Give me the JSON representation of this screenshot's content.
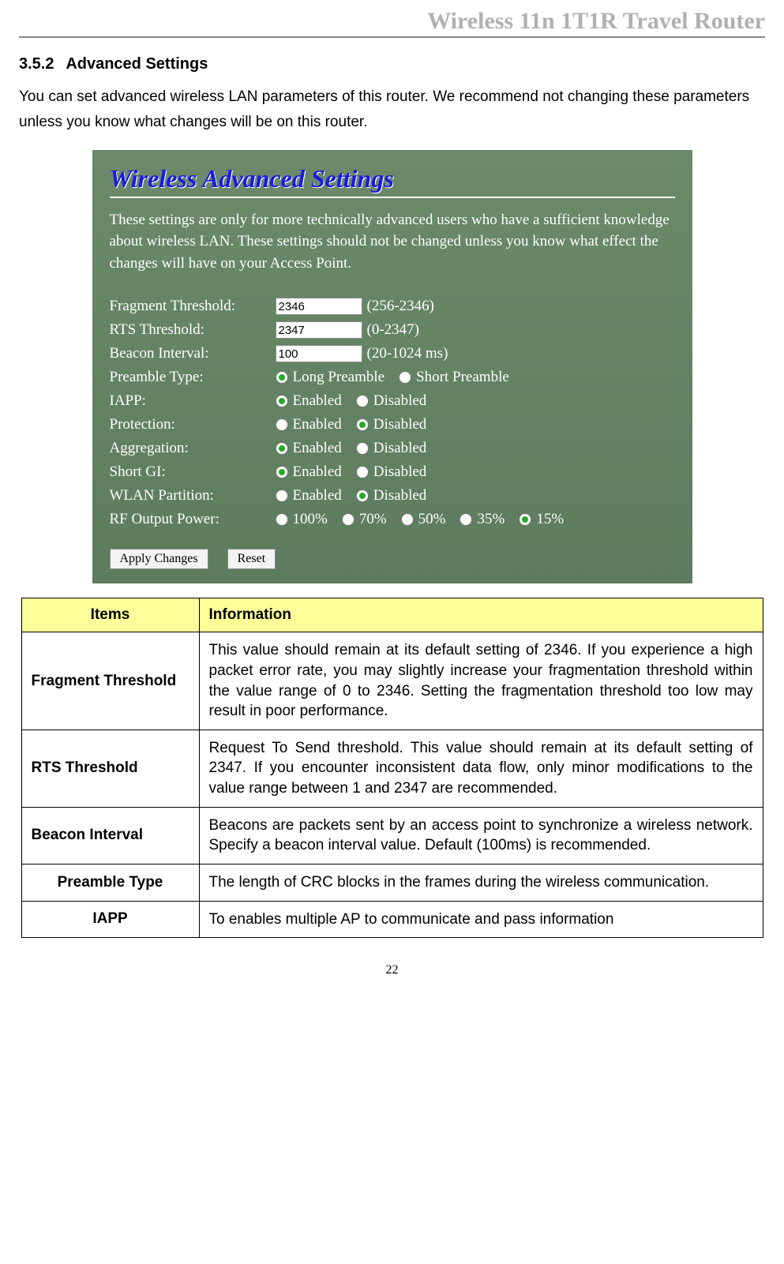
{
  "header": {
    "title": "Wireless 11n 1T1R Travel Router"
  },
  "section": {
    "number": "3.5.2",
    "title": "Advanced Settings",
    "intro": "You can set advanced wireless LAN parameters of this router. We recommend not changing these parameters unless you know what changes will be on this router."
  },
  "screenshot": {
    "title": "Wireless Advanced Settings",
    "desc": "These settings are only for more technically advanced users who have a sufficient knowledge about wireless LAN. These settings should not be changed unless you know what effect the changes will have on your Access Point.",
    "fields": {
      "fragment": {
        "label": "Fragment Threshold:",
        "value": "2346",
        "range": "(256-2346)"
      },
      "rts": {
        "label": "RTS Threshold:",
        "value": "2347",
        "range": "(0-2347)"
      },
      "beacon": {
        "label": "Beacon Interval:",
        "value": "100",
        "range": "(20-1024 ms)"
      },
      "preamble": {
        "label": "Preamble Type:",
        "opt1": "Long Preamble",
        "opt2": "Short Preamble",
        "selected": 0
      },
      "iapp": {
        "label": "IAPP:",
        "opt1": "Enabled",
        "opt2": "Disabled",
        "selected": 0
      },
      "protection": {
        "label": "Protection:",
        "opt1": "Enabled",
        "opt2": "Disabled",
        "selected": 1
      },
      "aggregation": {
        "label": "Aggregation:",
        "opt1": "Enabled",
        "opt2": "Disabled",
        "selected": 0
      },
      "shortgi": {
        "label": "Short GI:",
        "opt1": "Enabled",
        "opt2": "Disabled",
        "selected": 0
      },
      "wlan": {
        "label": "WLAN Partition:",
        "opt1": "Enabled",
        "opt2": "Disabled",
        "selected": 1
      },
      "rfpower": {
        "label": "RF Output Power:",
        "opts": [
          "100%",
          "70%",
          "50%",
          "35%",
          "15%"
        ],
        "selected": 4
      }
    },
    "buttons": {
      "apply": "Apply Changes",
      "reset": "Reset"
    }
  },
  "table": {
    "header": {
      "items": "Items",
      "info": "Information"
    },
    "rows": [
      {
        "item": "Fragment Threshold",
        "info": "This value should remain at its default setting of 2346. If you experience a high packet error rate, you may slightly increase your fragmentation threshold within the value range of 0 to 2346. Setting the fragmentation threshold too low may result in poor performance."
      },
      {
        "item": "RTS Threshold",
        "info": "Request To Send threshold. This value should remain at its default setting of 2347. If you encounter inconsistent data flow, only minor modifications to the value range between 1 and 2347 are recommended."
      },
      {
        "item": "Beacon Interval",
        "info": "Beacons are packets sent by an access point to synchronize a wireless network. Specify a beacon interval value. Default (100ms) is recommended."
      },
      {
        "item": "Preamble Type",
        "info": "The length of CRC blocks in the frames during the wireless communication."
      },
      {
        "item": "IAPP",
        "info": "To enables multiple AP to communicate and pass information"
      }
    ]
  },
  "page_number": "22"
}
